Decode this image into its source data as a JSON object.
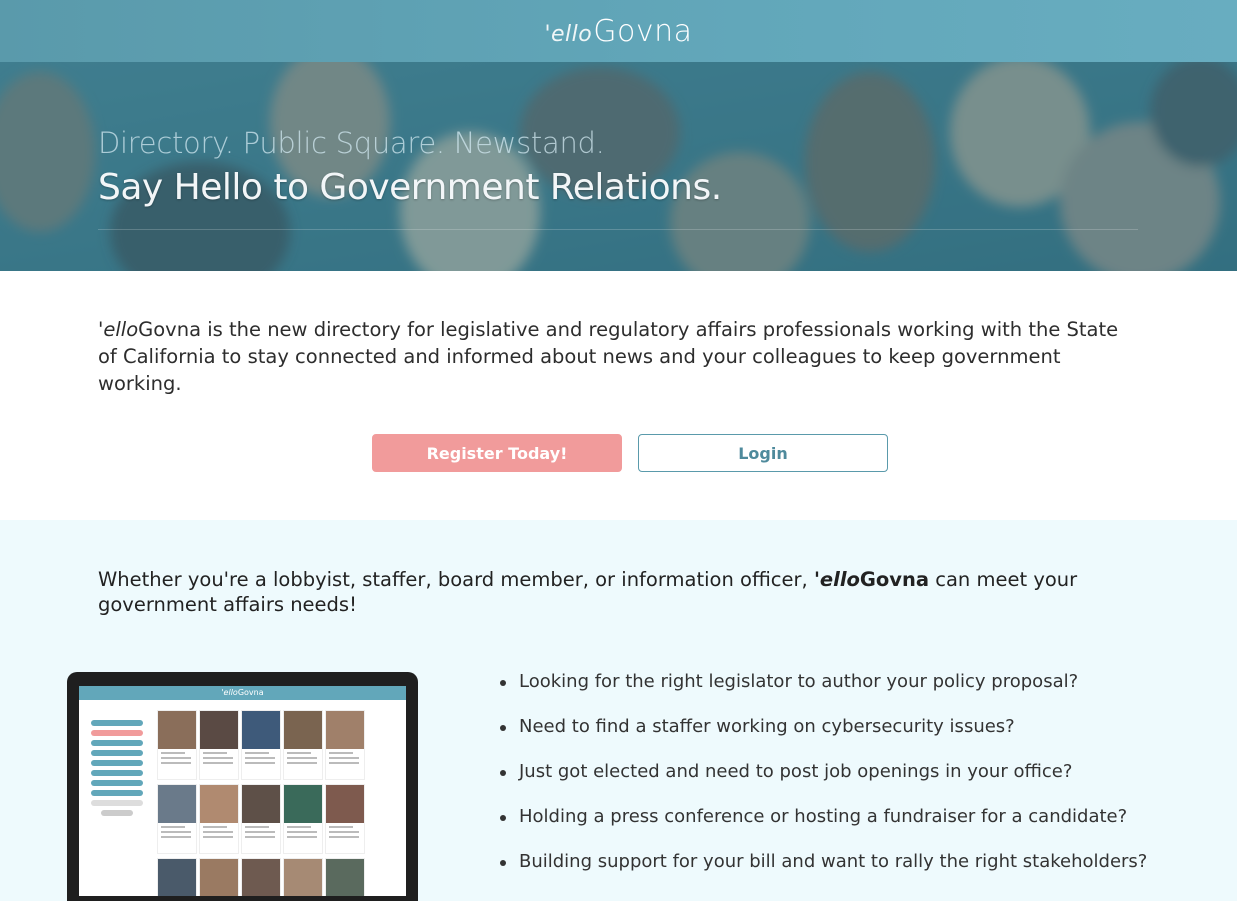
{
  "header": {
    "logo_prefix": "'ello",
    "logo_main": "Govna"
  },
  "hero": {
    "subtitle": "Directory. Public Square. Newstand.",
    "title": "Say Hello to Government Relations."
  },
  "intro": {
    "brand_prefix": "'ello",
    "brand_main": "Govna",
    "text": " is the new directory for legislative and regulatory affairs professionals working with the State of California to stay connected and informed about news and your colleagues to keep government working."
  },
  "actions": {
    "register_label": "Register Today!",
    "login_label": "Login"
  },
  "features": {
    "heading_start": "Whether you're a lobbyist, staffer, board member, or information officer, ",
    "brand_prefix": "'ello",
    "brand_main": "Govna",
    "heading_end": " can meet your government affairs needs!",
    "bullets": [
      "Looking for the right legislator to author your policy proposal?",
      "Need to find a staffer working on cybersecurity issues?",
      "Just got elected and need to post job openings in your office?",
      "Holding a press conference or hosting a fundraiser for a candidate?",
      "Building support for your bill and want to rally the right stakeholders?"
    ]
  },
  "mockup": {
    "logo_prefix": "'ello",
    "logo_main": "Govna"
  },
  "colors": {
    "header": "#62a7ba",
    "register": "#f19b9b",
    "login_text": "#4e8a9c",
    "section_bg": "#eefafd"
  }
}
